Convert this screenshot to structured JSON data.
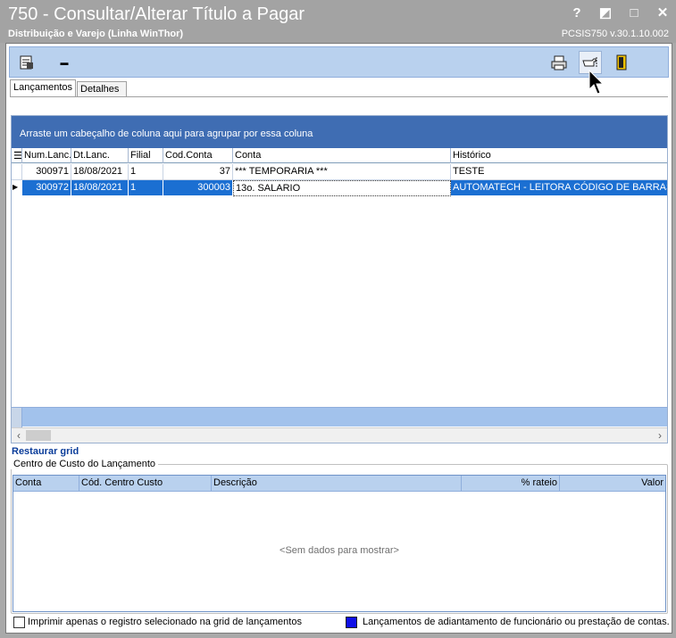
{
  "window": {
    "title": "750 - Consultar/Alterar Título a Pagar",
    "subtitle": "Distribuição e Varejo (Linha WinThor)",
    "version": "PCSIS750  v.30.1.10.002",
    "controls": [
      "?",
      "◩",
      "□",
      "✕"
    ]
  },
  "toolbar": {
    "left_icons": [
      "report-icon",
      "minus-icon"
    ],
    "right_icons": [
      "printer-icon",
      "hand-pointer-icon",
      "exit-door-icon"
    ],
    "minus_label": "▬"
  },
  "tabs": [
    {
      "label": "Lançamentos",
      "active": true
    },
    {
      "label": "Detalhes",
      "active": false
    }
  ],
  "grid": {
    "group_hint": "Arraste um cabeçalho de coluna aqui para agrupar por essa coluna",
    "columns": [
      "Num.Lanc.",
      "Dt.Lanc.",
      "Filial",
      "Cod.Conta",
      "Conta",
      "Histórico"
    ],
    "rows": [
      {
        "num": "300971",
        "dt": "18/08/2021",
        "filial": "1",
        "cod": "37",
        "conta": "*** TEMPORARIA ***",
        "historico": "TESTE",
        "selected": false
      },
      {
        "num": "300972",
        "dt": "18/08/2021",
        "filial": "1",
        "cod": "300003",
        "conta": "13o. SALARIO",
        "historico": "AUTOMATECH - LEITORA CÓDIGO DE BARRAS",
        "selected": true
      }
    ],
    "restore_link": "Restaurar grid"
  },
  "cost_center": {
    "legend": "Centro de Custo do Lançamento",
    "columns": [
      "Conta",
      "Cód. Centro Custo",
      "Descrição",
      "% rateio",
      "Valor"
    ],
    "empty_text": "<Sem dados para mostrar>"
  },
  "bottom": {
    "checkbox_label": "Imprimir apenas o registro selecionado na grid de lançamentos",
    "legend_label": "Lançamentos de adiantamento de funcionário ou prestação de contas.",
    "legend_color": "#1010e6"
  },
  "colors": {
    "toolbar": "#b9d1ee",
    "groupbar": "#3f6db3",
    "selected_row": "#1b6fd2"
  }
}
